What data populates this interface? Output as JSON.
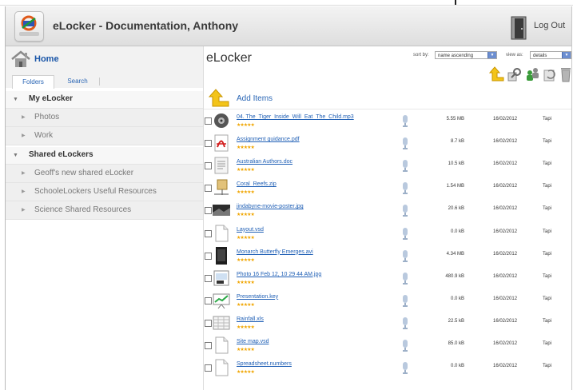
{
  "header": {
    "title": "eLocker - Documentation, Anthony",
    "logout_label": "Log Out",
    "logo_icon": "elocker-logo-icon",
    "logout_icon": "door-icon"
  },
  "sidebar": {
    "home_label": "Home",
    "tabs": [
      {
        "label": "Folders"
      },
      {
        "label": "Search"
      }
    ],
    "groups": [
      {
        "label": "My eLocker",
        "items": [
          {
            "label": "Photos"
          },
          {
            "label": "Work"
          }
        ]
      },
      {
        "label": "Shared eLockers",
        "items": [
          {
            "label": "Geoff's new shared eLocker"
          },
          {
            "label": "SchooleLockers Useful Resources"
          },
          {
            "label": "Science Shared Resources"
          }
        ]
      }
    ]
  },
  "main": {
    "title": "eLocker",
    "sort_label": "sort by:",
    "sort_value": "name ascending",
    "view_label": "view as:",
    "view_value": "details",
    "add_label": "Add Items",
    "rating_text": "★★★★★",
    "toolbar_icons": [
      "up-folder-icon",
      "search-magnifier-icon",
      "share-users-icon",
      "refresh-icon",
      "trash-icon"
    ],
    "files": [
      {
        "name": "04. The_Tiger_Inside_Will_Eat_The_Child.mp3",
        "size": "5.55 MB",
        "date": "16/02/2012",
        "owner": "Tapi",
        "thumb": "audio-file-icon"
      },
      {
        "name": "Assignment guidance.pdf",
        "size": "8.7 kB",
        "date": "16/02/2012",
        "owner": "Tapi",
        "thumb": "pdf-file-icon"
      },
      {
        "name": "Australian Authors.doc",
        "size": "10.5 kB",
        "date": "16/02/2012",
        "owner": "Tapi",
        "thumb": "document-file-icon"
      },
      {
        "name": "Coral_Reefs.zip",
        "size": "1.54 MB",
        "date": "16/02/2012",
        "owner": "Tapi",
        "thumb": "zip-file-icon"
      },
      {
        "name": "jindabyne-movie-poster.jpg",
        "size": "20.6 kB",
        "date": "16/02/2012",
        "owner": "Tapi",
        "thumb": "image-thumbnail-icon"
      },
      {
        "name": "Layout.vsd",
        "size": "0.0 kB",
        "date": "16/02/2012",
        "owner": "Tapi",
        "thumb": "blank-file-icon"
      },
      {
        "name": "Monarch Butterfly Emerges.avi",
        "size": "4.34 MB",
        "date": "16/02/2012",
        "owner": "Tapi",
        "thumb": "video-file-icon"
      },
      {
        "name": "Photo 16 Feb 12, 10 29 44 AM.jpg",
        "size": "480.9 kB",
        "date": "16/02/2012",
        "owner": "Tapi",
        "thumb": "photo-thumbnail-icon"
      },
      {
        "name": "Presentation.key",
        "size": "0.0 kB",
        "date": "16/02/2012",
        "owner": "Tapi",
        "thumb": "presentation-file-icon"
      },
      {
        "name": "Rainfall.xls",
        "size": "22.5 kB",
        "date": "16/02/2012",
        "owner": "Tapi",
        "thumb": "spreadsheet-file-icon"
      },
      {
        "name": "Site map.vsd",
        "size": "85.0 kB",
        "date": "16/02/2012",
        "owner": "Tapi",
        "thumb": "blank-file-icon"
      },
      {
        "name": "Spreadsheet.numbers",
        "size": "0.0 kB",
        "date": "16/02/2012",
        "owner": "Tapi",
        "thumb": "blank-file-icon"
      }
    ]
  },
  "colors": {
    "link": "#1f5fb5",
    "star": "#f0a500",
    "header_bg": "#e6e6e6",
    "sidebar_item_bg": "#efefef"
  }
}
